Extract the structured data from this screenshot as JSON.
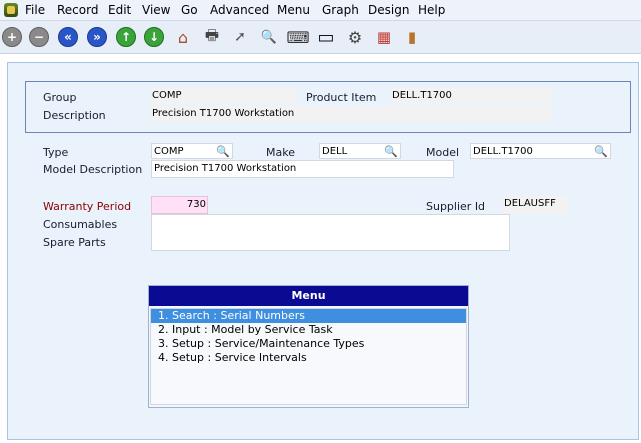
{
  "menubar": {
    "items": [
      "File",
      "Record",
      "Edit",
      "View",
      "Go",
      "Advanced",
      "Menu",
      "Graph",
      "Design",
      "Help"
    ]
  },
  "toolbar": {
    "buttons": [
      {
        "icon": "add-circle-icon",
        "glyph": "+"
      },
      {
        "icon": "remove-circle-icon",
        "glyph": "−"
      },
      {
        "icon": "first-record-icon",
        "glyph": "«"
      },
      {
        "icon": "last-record-icon",
        "glyph": "»"
      },
      {
        "icon": "up-arrow-icon",
        "glyph": "↑"
      },
      {
        "icon": "down-arrow-icon",
        "glyph": "↓"
      },
      {
        "icon": "home-icon",
        "glyph": "⌂"
      },
      {
        "icon": "printer-icon",
        "glyph": "🖶"
      },
      {
        "icon": "cursor-icon",
        "glyph": "➚"
      },
      {
        "icon": "search-icon",
        "glyph": "🔍"
      },
      {
        "icon": "keyboard-icon",
        "glyph": "⌨"
      },
      {
        "icon": "monitor-icon",
        "glyph": "▭"
      },
      {
        "icon": "settings-gear-icon",
        "glyph": "⚙"
      },
      {
        "icon": "calendar-icon",
        "glyph": "▦"
      },
      {
        "icon": "exit-door-icon",
        "glyph": "▮"
      }
    ]
  },
  "header": {
    "group_label": "Group",
    "group_value": "COMP",
    "product_item_label": "Product Item",
    "product_item_value": "DELL.T1700",
    "description_label": "Description",
    "description_value": "Precision T1700 Workstation"
  },
  "form": {
    "type_label": "Type",
    "type_value": "COMP",
    "make_label": "Make",
    "make_value": "DELL",
    "model_label": "Model",
    "model_value": "DELL.T1700",
    "model_description_label": "Model Description",
    "model_description_value": "Precision T1700 Workstation",
    "warranty_period_label": "Warranty Period",
    "warranty_period_value": "730",
    "supplier_id_label": "Supplier Id",
    "supplier_id_value": "DELAUSFF",
    "consumables_label": "Consumables",
    "spare_parts_label": "Spare Parts"
  },
  "menu_panel": {
    "title": "Menu",
    "items": [
      "1. Search : Serial Numbers",
      "2. Input : Model by Service Task",
      "3. Setup : Service/Maintenance Types",
      "4. Setup : Service Intervals"
    ],
    "selected_index": 0
  },
  "colors": {
    "menu_title_bg": "#0a0a92",
    "selected_row_bg": "#3e8fe0",
    "warranty_field_bg": "#ffe0f6",
    "content_bg": "#eaf3fc"
  }
}
